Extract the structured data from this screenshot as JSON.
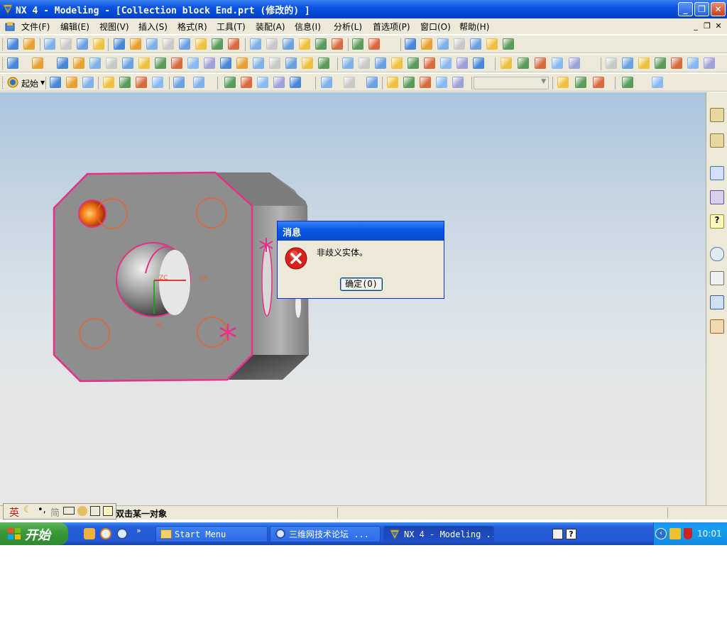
{
  "window": {
    "title": "NX 4 - Modeling - [Collection block End.prt (修改的) ]"
  },
  "menu": {
    "items": [
      "文件(F)",
      "编辑(E)",
      "视图(V)",
      "插入(S)",
      "格式(R)",
      "工具(T)",
      "装配(A)",
      "信息(I)",
      "分析(L)",
      "首选项(P)",
      "窗口(O)",
      "帮助(H)"
    ]
  },
  "toolbar": {
    "start_label": "起始"
  },
  "canvas": {
    "axis_xc": "XC",
    "axis_yc": "YC",
    "axis_zc": "ZC"
  },
  "dialog": {
    "title": "消息",
    "message": "非歧义实体。",
    "ok_label": "确定(O)"
  },
  "status": {
    "prompt": "双击某一对象",
    "ime_items": [
      "英",
      "简"
    ]
  },
  "taskbar": {
    "start_label": "开始",
    "tasks": [
      "Start Menu",
      "三维网技术论坛 ...",
      "NX 4 - Modeling ..."
    ],
    "clock": "10:01"
  },
  "colors": {
    "highlight": "#e8308a",
    "edge_orange": "#e8642a",
    "accent_blue": "#0a53e0"
  }
}
